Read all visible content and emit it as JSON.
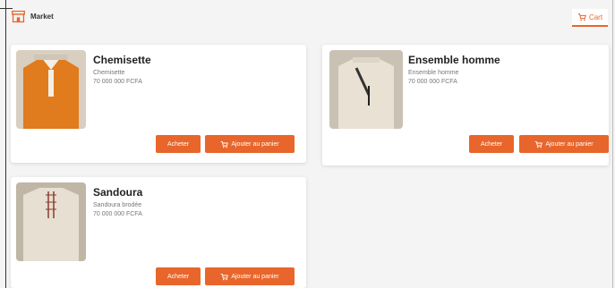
{
  "app": {
    "brand": "Market"
  },
  "header": {
    "cart_label": "Cart"
  },
  "colors": {
    "accent": "#e8662b"
  },
  "products": [
    {
      "title": "Chemisette",
      "description": "Chemisette",
      "price": "70 000 000 FCFA",
      "buy_label": "Acheter",
      "add_label": "Ajouter au panier"
    },
    {
      "title": "Ensemble homme",
      "description": "Ensemble homme",
      "price": "70 000 000 FCFA",
      "buy_label": "Acheter",
      "add_label": "Ajouter au panier"
    },
    {
      "title": "Sandoura",
      "description": "Sandoura brodée",
      "price": "70 000 000 FCFA",
      "buy_label": "Acheter",
      "add_label": "Ajouter au panier"
    }
  ]
}
